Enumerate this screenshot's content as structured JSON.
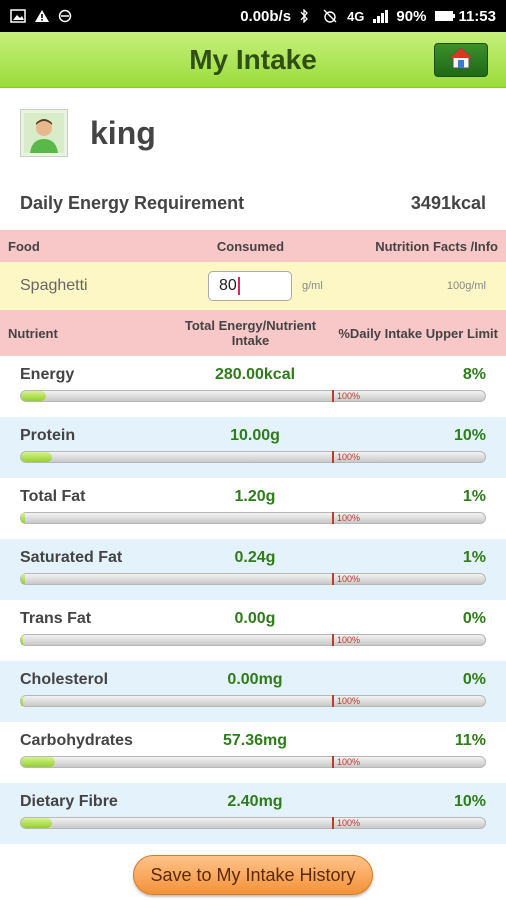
{
  "status_bar": {
    "speed": "0.00b/s",
    "signal": "4G",
    "battery": "90%",
    "time": "11:53"
  },
  "header": {
    "title": "My Intake",
    "home_icon": "home-icon"
  },
  "profile": {
    "name": "king",
    "avatar_icon": "user-avatar"
  },
  "requirement": {
    "label": "Daily Energy Requirement",
    "value": "3491kcal"
  },
  "food_header": {
    "food": "Food",
    "consumed": "Consumed",
    "info": "Nutrition Facts /Info"
  },
  "food": {
    "name": "Spaghetti",
    "amount": "80",
    "unit": "g/ml",
    "per": "100g/ml"
  },
  "nutrient_header": {
    "nutrient": "Nutrient",
    "total": "Total Energy/Nutrient Intake",
    "daily": "%Daily Intake Upper Limit"
  },
  "marker_label": "100%",
  "nutrients": [
    {
      "name": "Energy",
      "amount": "280.00kcal",
      "percent": "8%",
      "fill_pct": 8
    },
    {
      "name": "Protein",
      "amount": "10.00g",
      "percent": "10%",
      "fill_pct": 10
    },
    {
      "name": "Total Fat",
      "amount": "1.20g",
      "percent": "1%",
      "fill_pct": 1
    },
    {
      "name": "Saturated Fat",
      "amount": "0.24g",
      "percent": "1%",
      "fill_pct": 1
    },
    {
      "name": "Trans Fat",
      "amount": "0.00g",
      "percent": "0%",
      "fill_pct": 0
    },
    {
      "name": "Cholesterol",
      "amount": "0.00mg",
      "percent": "0%",
      "fill_pct": 0
    },
    {
      "name": "Carbohydrates",
      "amount": "57.36mg",
      "percent": "11%",
      "fill_pct": 11
    },
    {
      "name": "Dietary Fibre",
      "amount": "2.40mg",
      "percent": "10%",
      "fill_pct": 10
    }
  ],
  "save_button": "Save to My Intake History"
}
